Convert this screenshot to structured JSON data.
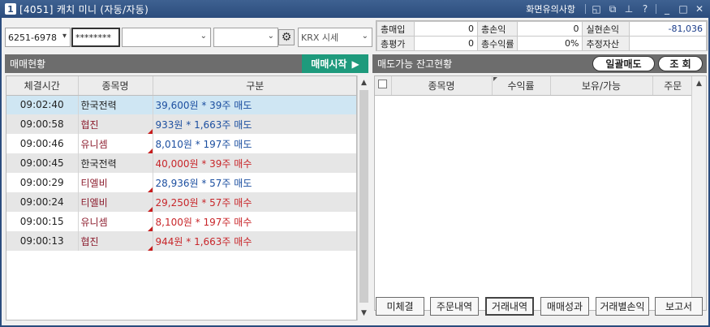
{
  "window": {
    "num": "1",
    "title": "[4051] 캐치 미니 (자동/자동)",
    "notice": "화면유의사항"
  },
  "controls": {
    "account": "6251-6978",
    "password": "********",
    "market": "KRX 시세"
  },
  "summary": {
    "total_buy_label": "총매입",
    "total_buy": "0",
    "total_pnl_label": "총손익",
    "total_pnl": "0",
    "realized_label": "실현손익",
    "realized": "-81,036",
    "total_eval_label": "총평가",
    "total_eval": "0",
    "total_rate_label": "총수익률",
    "total_rate": "0%",
    "est_asset_label": "추정자산",
    "est_asset": ""
  },
  "left": {
    "header": "매매현황",
    "start_button": "매매시작",
    "columns": [
      "체결시간",
      "종목명",
      "구분"
    ],
    "rows": [
      {
        "time": "09:02:40",
        "name": "한국전력",
        "detail": "39,600원 * 39주 매도",
        "side": "sell",
        "style": "sel",
        "red_name": false
      },
      {
        "time": "09:00:58",
        "name": "협진",
        "detail": "933원 * 1,663주 매도",
        "side": "sell",
        "style": "even",
        "red_name": true
      },
      {
        "time": "09:00:46",
        "name": "유니셈",
        "detail": "8,010원 * 197주 매도",
        "side": "sell",
        "style": "odd",
        "red_name": true
      },
      {
        "time": "09:00:45",
        "name": "한국전력",
        "detail": "40,000원 * 39주 매수",
        "side": "buy",
        "style": "even",
        "red_name": false
      },
      {
        "time": "09:00:29",
        "name": "티엘비",
        "detail": "28,936원 * 57주 매도",
        "side": "sell",
        "style": "odd",
        "red_name": true
      },
      {
        "time": "09:00:24",
        "name": "티엘비",
        "detail": "29,250원 * 57주 매수",
        "side": "buy",
        "style": "even",
        "red_name": true
      },
      {
        "time": "09:00:15",
        "name": "유니셈",
        "detail": "8,100원 * 197주 매수",
        "side": "buy",
        "style": "odd",
        "red_name": true
      },
      {
        "time": "09:00:13",
        "name": "협진",
        "detail": "944원 * 1,663주 매수",
        "side": "buy",
        "style": "even",
        "red_name": true
      }
    ]
  },
  "right": {
    "header": "매도가능 잔고현황",
    "sell_all": "일괄매도",
    "inquiry": "조 회",
    "columns": [
      "종목명",
      "수익률",
      "보유/가능",
      "주문"
    ],
    "buttons": [
      "미체결",
      "주문내역",
      "거래내역",
      "매매성과",
      "거래별손익",
      "보고서"
    ]
  },
  "colors": {
    "sell": "#1c4fa0",
    "buy": "#c8262a",
    "start": "#1e9a7c"
  }
}
